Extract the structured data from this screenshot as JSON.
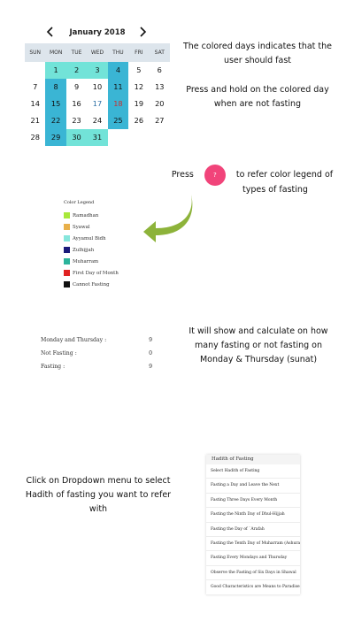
{
  "calendar": {
    "month_label": "January 2018",
    "weekdays": [
      "SUN",
      "MON",
      "TUE",
      "WED",
      "THU",
      "FRI",
      "SAT"
    ],
    "weeks": [
      [
        {
          "d": ""
        },
        {
          "d": "1",
          "t": "ayyamul"
        },
        {
          "d": "2",
          "t": "ayyamul"
        },
        {
          "d": "3",
          "t": "ayyamul"
        },
        {
          "d": "4",
          "t": "mon-thu"
        },
        {
          "d": "5"
        },
        {
          "d": "6"
        }
      ],
      [
        {
          "d": "7"
        },
        {
          "d": "8",
          "t": "mon-thu"
        },
        {
          "d": "9"
        },
        {
          "d": "10"
        },
        {
          "d": "11",
          "t": "mon-thu"
        },
        {
          "d": "12"
        },
        {
          "d": "13"
        }
      ],
      [
        {
          "d": "14"
        },
        {
          "d": "15",
          "t": "mon-thu"
        },
        {
          "d": "16"
        },
        {
          "d": "17",
          "t": "today"
        },
        {
          "d": "18",
          "t": "mon-thu",
          "red": true
        },
        {
          "d": "19"
        },
        {
          "d": "20"
        }
      ],
      [
        {
          "d": "21"
        },
        {
          "d": "22",
          "t": "mon-thu"
        },
        {
          "d": "23"
        },
        {
          "d": "24"
        },
        {
          "d": "25",
          "t": "mon-thu"
        },
        {
          "d": "26"
        },
        {
          "d": "27"
        }
      ],
      [
        {
          "d": "28"
        },
        {
          "d": "29",
          "t": "mon-thu"
        },
        {
          "d": "30",
          "t": "ayyamul"
        },
        {
          "d": "31",
          "t": "ayyamul"
        },
        {
          "d": ""
        },
        {
          "d": ""
        },
        {
          "d": ""
        }
      ]
    ]
  },
  "instructions": {
    "colored_days": "The colored days indicates that the user should fast",
    "press_hold": "Press and hold on the colored day when are not fasting",
    "press_prefix": "Press",
    "press_suffix_1": "to refer color legend of",
    "press_suffix_2": "types of fasting",
    "legend_button_glyph": "?",
    "stats_info": "It will show and calculate on how many fasting or not fasting on Monday & Thursday (sunat)",
    "dropdown_info": "Click on Dropdown menu to select Hadith of fasting you want to refer with"
  },
  "legend": {
    "title": "Color Legend",
    "items": [
      {
        "label": "Ramadhan",
        "color": "#a8e83a"
      },
      {
        "label": "Syawal",
        "color": "#e8b04a"
      },
      {
        "label": "Ayyamul Bidh",
        "color": "#86e6dc"
      },
      {
        "label": "Zulhijjah",
        "color": "#1a1a7a"
      },
      {
        "label": "Muharram",
        "color": "#2bb39b"
      },
      {
        "label": "First Day of Month",
        "color": "#e02222"
      },
      {
        "label": "Cannot Fasting",
        "color": "#111111"
      }
    ]
  },
  "stats": {
    "rows": [
      {
        "label": "Monday and Thursday :",
        "value": "9"
      },
      {
        "label": "Not Fasting :",
        "value": "0"
      },
      {
        "label": "Fasting :",
        "value": "9"
      }
    ]
  },
  "hadith": {
    "title": "Hadith of Fasting",
    "options": [
      "Select Hadith of Fasting",
      "Fasting a Day and Leave the Next",
      "Fasting Three Days Every Month",
      "Fasting the Ninth Day of Dhul-Hijjah",
      "Fasting the Day of `Arafah",
      "Fasting the Tenth Day of Muharram (Ashura)",
      "Fasting Every Mondays and Thursday",
      "Observe the Fasting of Six Days in Shawal",
      "Good Characteristics are Means to Paradise"
    ]
  },
  "colors": {
    "ayyamul_cell": "#72e3d8",
    "mon_thu_cell": "#3ab5d4",
    "legend_button": "#f1447a",
    "arrow": "#8db33a",
    "weekday_header_bg": "#dde5ec"
  },
  "icons": {
    "prev": "chevron-left-icon",
    "next": "chevron-right-icon",
    "arrow": "curved-arrow-icon"
  }
}
